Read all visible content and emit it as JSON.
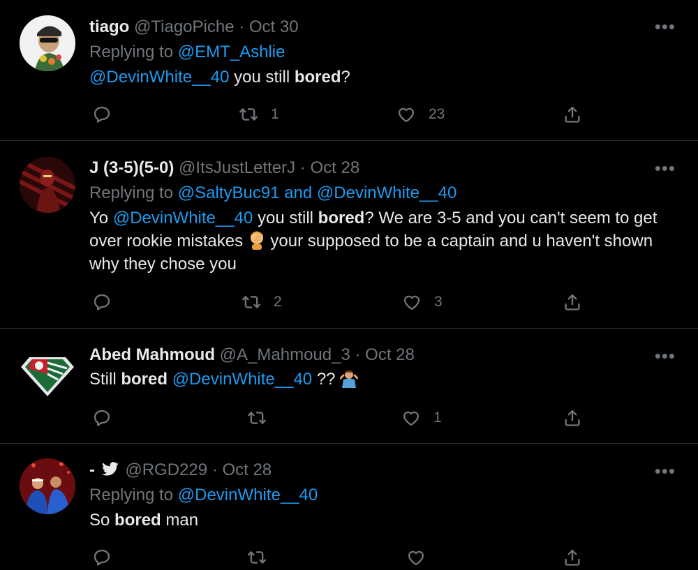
{
  "tweets": [
    {
      "name": "tiago",
      "handle": "@TiagoPiche",
      "dot": "·",
      "date": "Oct 30",
      "replying_prefix": "Replying to",
      "replying_to": "@EMT_Ashlie",
      "text": {
        "m1": "@DevinWhite__40",
        "t1": " you still ",
        "b1": "bored",
        "t2": "?"
      },
      "reply_count": "",
      "retweet_count": "1",
      "like_count": "23"
    },
    {
      "name": "J (3-5)(5-0)",
      "handle": "@ItsJustLetterJ",
      "dot": "·",
      "date": "Oct 28",
      "replying_prefix": "Replying to",
      "replying_to": "@SaltyBuc91 and @DevinWhite__40",
      "text": {
        "t0": "Yo ",
        "m1": "@DevinWhite__40",
        "t1": " you still ",
        "b1": "bored",
        "t2": "? We are 3-5 and you can't seem to get over rookie mistakes ",
        "t3": " your supposed to be a captain and u haven't shown why they chose you"
      },
      "reply_count": "",
      "retweet_count": "2",
      "like_count": "3"
    },
    {
      "name": "Abed Mahmoud",
      "handle": "@A_Mahmoud_3",
      "dot": "·",
      "date": "Oct 28",
      "text": {
        "t0": "Still ",
        "b1": "bored",
        "t1": " ",
        "m1": "@DevinWhite__40",
        "t2": " ?? "
      },
      "reply_count": "",
      "retweet_count": "",
      "like_count": "1"
    },
    {
      "name": "-",
      "handle": "@RGD229",
      "dot": "·",
      "date": "Oct 28",
      "replying_prefix": "Replying to",
      "replying_to": "@DevinWhite__40",
      "text": {
        "t0": "So ",
        "b1": "bored",
        "t1": " man"
      },
      "reply_count": "",
      "retweet_count": "",
      "like_count": ""
    }
  ],
  "more_label": "•••",
  "colors": {
    "background": "#000000",
    "text": "#e7e9ea",
    "muted": "#71767b",
    "link": "#1d9bf0",
    "divider": "#2f3336"
  },
  "icons": [
    "reply-icon",
    "retweet-icon",
    "like-icon",
    "share-icon",
    "more-icon",
    "bird-icon"
  ]
}
